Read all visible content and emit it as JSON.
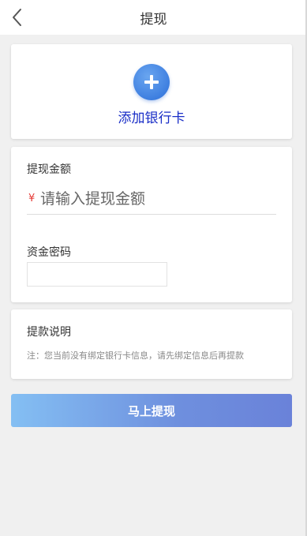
{
  "header": {
    "title": "提现",
    "back_icon": "chevron-left-icon"
  },
  "bank_card": {
    "add_label": "添加银行卡",
    "add_icon": "plus-icon"
  },
  "withdraw_form": {
    "amount_label": "提现金额",
    "currency_symbol": "¥",
    "amount_placeholder": "请输入提现金额",
    "amount_value": "",
    "password_label": "资金密码",
    "password_value": ""
  },
  "instructions": {
    "title": "提款说明",
    "note": "注：您当前没有绑定银行卡信息，请先绑定信息后再提款"
  },
  "submit": {
    "label": "马上提现"
  },
  "colors": {
    "accent_blue": "#3e7fe0",
    "link_text": "#1a2ec7",
    "currency_red": "#e53935",
    "button_gradient_start": "#84bff3",
    "button_gradient_end": "#6a82d9",
    "page_background": "#f0f0f0"
  }
}
